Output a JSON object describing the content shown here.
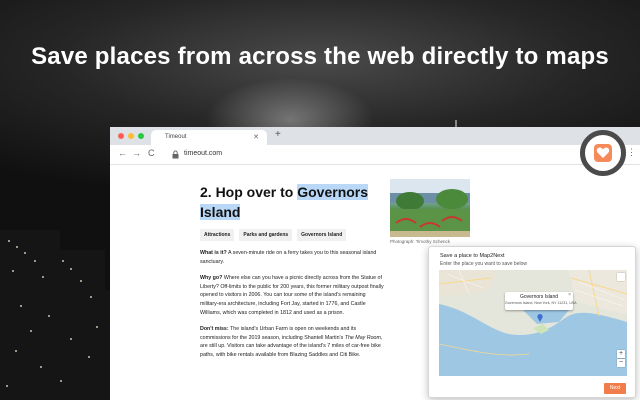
{
  "headline": "Save places from across the web directly to maps",
  "browser": {
    "tab_title": "Timeout",
    "tab_close": "✕",
    "new_tab": "+",
    "url": "timeout.com",
    "nav": {
      "back": "←",
      "forward": "→",
      "reload": "C"
    },
    "star": "☆",
    "menu": "⋮"
  },
  "article": {
    "title_prefix": "2. Hop over to ",
    "title_highlight_1": "Governors",
    "title_highlight_2": "Island",
    "tags": [
      "Attractions",
      "Parks and gardens",
      "Governors Island"
    ],
    "photo_caption": "Photograph: Timothy Schenck",
    "paragraphs": [
      {
        "label": "What is it?",
        "text": " A seven-minute ride on a ferry takes you to this seasonal island sanctuary."
      },
      {
        "label": "Why go?",
        "text": " Where else can you have a picnic directly across from the Statue of Liberty? Off-limits to the public for 200 years, this former military outpost finally opened to visitors in 2006. You can tour some of the island's remaining military-era architecture, including Fort Jay, started in 1776, and Castle Williams, which was completed in 1812 and used as a prison."
      },
      {
        "label": "Don't miss:",
        "text_before_italic": " The island's Urban Farm is open on weekends and its commissions for the 2019 season, including Shantell Martin's ",
        "italic": "The May Room",
        "text_after_italic": ", are still up. Visitors can take advantage of the island's 7 miles of car-free bike paths, with bike rentals available from Blazing Saddles and Citi Bike."
      }
    ]
  },
  "popup": {
    "title": "Save a place to Map2Next",
    "subtitle": "Enter the place you want to save below",
    "map_tooltip_name": "Governors Island",
    "map_tooltip_address": "Governors Island, New York, NY 11231, USA",
    "map_tooltip_close": "×",
    "zoom_in": "+",
    "zoom_out": "−",
    "next_button": "Next"
  },
  "colors": {
    "accent_orange": "#f07d4a",
    "highlight_blue": "#b9d8f7",
    "ring_gray": "#4b4b4b"
  },
  "icons": {
    "extension": "heart-icon",
    "lock": "lock-icon",
    "bookmark": "star-icon",
    "map_pin": "map-pin-icon"
  }
}
